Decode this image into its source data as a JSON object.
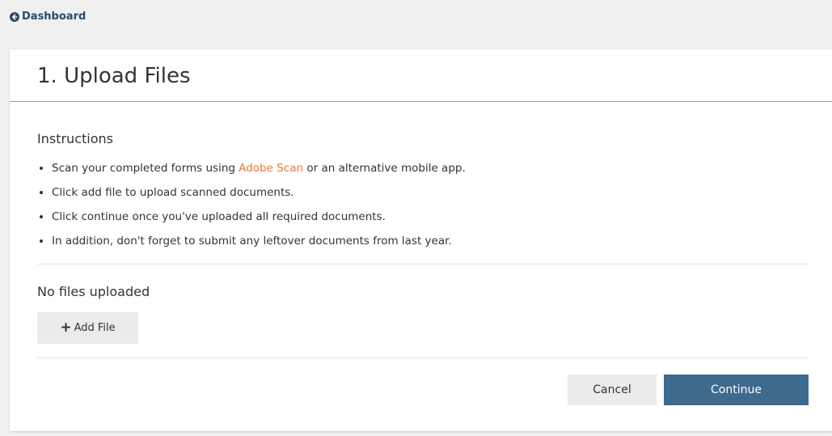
{
  "nav": {
    "back_label": "Dashboard"
  },
  "page": {
    "title": "1. Upload Files"
  },
  "instructions": {
    "heading": "Instructions",
    "item1_prefix": "Scan your completed forms using ",
    "item1_link": "Adobe Scan",
    "item1_suffix": " or an alternative mobile app.",
    "item2": "Click add file to upload scanned documents.",
    "item3": "Click continue once you've uploaded all required documents.",
    "item4": "In addition, don't forget to submit any leftover documents from last year."
  },
  "files": {
    "empty_message": "No files uploaded",
    "add_label": "Add File"
  },
  "actions": {
    "cancel_label": "Cancel",
    "continue_label": "Continue"
  },
  "colors": {
    "accent_link": "#e8783c",
    "primary_button": "#3e6a8e",
    "nav_link": "#2c4a66"
  },
  "icons": {
    "back": "arrow-circle-left-icon",
    "add": "plus-icon"
  }
}
